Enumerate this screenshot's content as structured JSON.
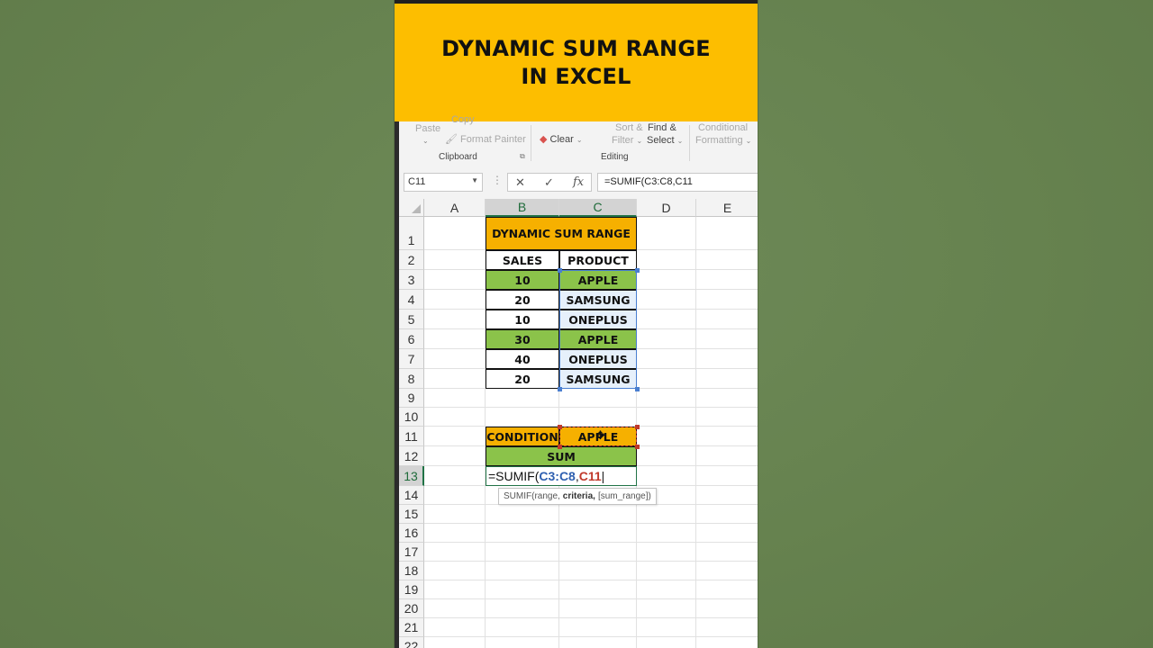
{
  "banner": {
    "line1": "DYNAMIC SUM RANGE",
    "line2": "IN EXCEL"
  },
  "ribbon": {
    "paste": "Paste",
    "copy": "Copy",
    "format_painter": "Format Painter",
    "clipboard_group": "Clipboard",
    "clear": "Clear",
    "sort_filter_1": "Sort &",
    "sort_filter_2": "Filter",
    "find_select_1": "Find &",
    "find_select_2": "Select",
    "editing_group": "Editing",
    "cond_format_1": "Conditional",
    "cond_format_2": "Formatting"
  },
  "formula_bar": {
    "name_box": "C11",
    "formula": "=SUMIF(C3:C8,C11"
  },
  "columns": [
    "A",
    "B",
    "C",
    "D",
    "E"
  ],
  "rows": [
    "1",
    "2",
    "3",
    "4",
    "5",
    "6",
    "7",
    "8",
    "9",
    "10",
    "11",
    "12",
    "13",
    "14",
    "15",
    "16",
    "17",
    "18",
    "19",
    "20",
    "21",
    "22"
  ],
  "table": {
    "title": "DYNAMIC SUM RANGE",
    "header_sales": "SALES",
    "header_product": "PRODUCT",
    "data": [
      {
        "sales": "10",
        "product": "APPLE"
      },
      {
        "sales": "20",
        "product": "SAMSUNG"
      },
      {
        "sales": "10",
        "product": "ONEPLUS"
      },
      {
        "sales": "30",
        "product": "APPLE"
      },
      {
        "sales": "40",
        "product": "ONEPLUS"
      },
      {
        "sales": "20",
        "product": "SAMSUNG"
      }
    ],
    "condition_label": "CONDITION",
    "condition_value": "APPLE",
    "sum_label": "SUM"
  },
  "edit_cell": {
    "prefix": "=SUMIF(",
    "ref1": "C3:C8",
    "comma": ",",
    "ref2": "C11"
  },
  "tooltip": {
    "fn": "SUMIF(range,",
    "arg": "criteria,",
    "rest": "[sum_range])"
  },
  "colors": {
    "banner": "#fdbe00",
    "green": "#8bc34a",
    "orange": "#f6b000",
    "excel_green": "#217346"
  }
}
